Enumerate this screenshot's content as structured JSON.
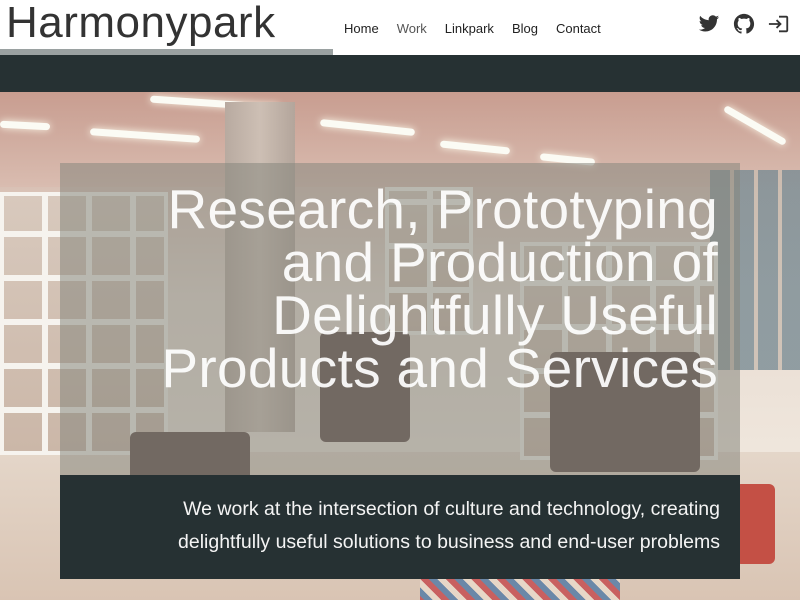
{
  "header": {
    "brand": "Harmonypark",
    "nav": [
      {
        "label": "Home"
      },
      {
        "label": "Work"
      },
      {
        "label": "Linkpark"
      },
      {
        "label": "Blog"
      },
      {
        "label": "Contact"
      }
    ],
    "icons": [
      "twitter-icon",
      "github-icon",
      "sign-in-icon"
    ]
  },
  "hero": {
    "headline_lines": [
      "Research, Prototyping",
      "and Production of",
      "Delightfully Useful",
      "Products and Services"
    ],
    "subtext_lines": [
      "We work at the intersection of culture and technology, creating",
      "delightfully useful solutions to business and end-user problems"
    ]
  },
  "colors": {
    "dark_teal": "#263133",
    "header_bg": "#ffffff",
    "underline": "#9aa1a1"
  }
}
